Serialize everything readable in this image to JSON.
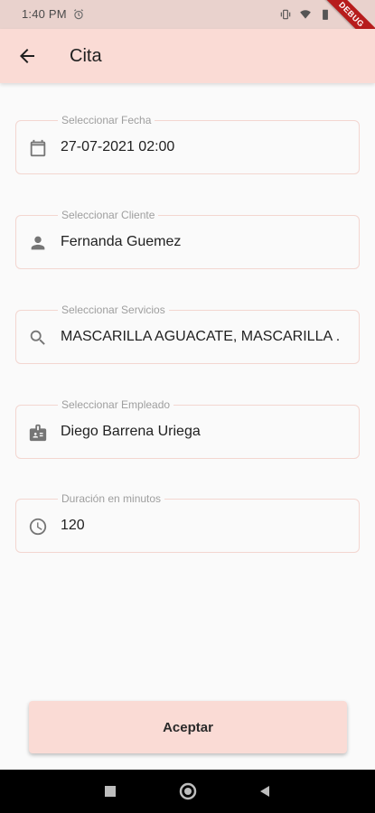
{
  "status_bar": {
    "time": "1:40 PM",
    "debug_label": "DEBUG"
  },
  "app_bar": {
    "title": "Cita"
  },
  "form": {
    "fecha": {
      "label": "Seleccionar Fecha",
      "value": "27-07-2021 02:00",
      "icon": "calendar-icon"
    },
    "cliente": {
      "label": "Seleccionar Cliente",
      "value": "Fernanda Guemez",
      "icon": "person-icon"
    },
    "servicios": {
      "label": "Seleccionar Servicios",
      "value": "MASCARILLA AGUACATE, MASCARILLA .",
      "icon": "search-icon"
    },
    "empleado": {
      "label": "Seleccionar Empleado",
      "value": "Diego Barrena Uriega",
      "icon": "badge-icon"
    },
    "duracion": {
      "label": "Duración en minutos",
      "value": "120",
      "icon": "clock-icon"
    }
  },
  "actions": {
    "accept_label": "Aceptar"
  },
  "colors": {
    "app_bar": "#fadbd5",
    "status_bar": "#e9d2cd",
    "field_border": "#f3d6d0",
    "button": "#fadbd5"
  }
}
